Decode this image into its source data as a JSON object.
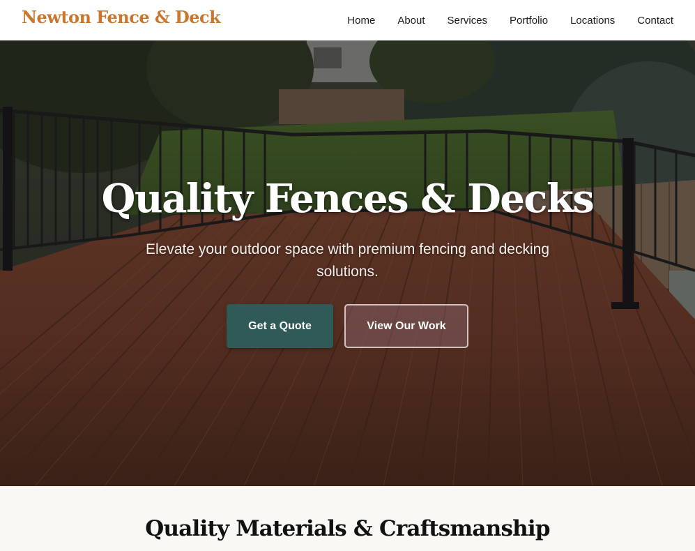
{
  "header": {
    "logo": "Newton Fence & Deck",
    "nav": [
      "Home",
      "About",
      "Services",
      "Portfolio",
      "Locations",
      "Contact"
    ]
  },
  "hero": {
    "title": "Quality Fences & Decks",
    "subtitle": "Elevate your outdoor space with premium fencing and decking solutions.",
    "primary_cta": "Get a Quote",
    "secondary_cta": "View Our Work"
  },
  "features": {
    "title": "Quality Materials & Craftsmanship"
  },
  "colors": {
    "brand_orange": "#c9772f",
    "primary_button": "#2f5a57",
    "deck_brown": "#6b3a28",
    "page_background": "#faf8f5"
  }
}
